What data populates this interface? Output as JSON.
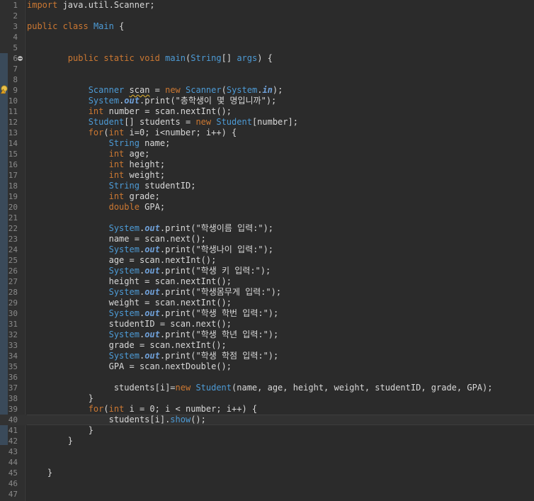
{
  "editor": {
    "lines": [
      {
        "n": "1",
        "t": [
          [
            "kw",
            "import"
          ],
          [
            "plain",
            " java.util.Scanner;"
          ]
        ]
      },
      {
        "n": "2",
        "t": []
      },
      {
        "n": "3",
        "t": [
          [
            "kw",
            "public"
          ],
          [
            "plain",
            " "
          ],
          [
            "kw",
            "class"
          ],
          [
            "plain",
            " "
          ],
          [
            "cls",
            "Main"
          ],
          [
            "plain",
            " {"
          ]
        ]
      },
      {
        "n": "4",
        "t": []
      },
      {
        "n": "5",
        "t": []
      },
      {
        "n": "6",
        "fold": true,
        "t": [
          [
            "plain",
            "        "
          ],
          [
            "kw",
            "public"
          ],
          [
            "plain",
            " "
          ],
          [
            "kw",
            "static"
          ],
          [
            "plain",
            " "
          ],
          [
            "kw",
            "void"
          ],
          [
            "plain",
            " "
          ],
          [
            "type",
            "main"
          ],
          [
            "plain",
            "("
          ],
          [
            "type",
            "String"
          ],
          [
            "plain",
            "[] "
          ],
          [
            "type",
            "args"
          ],
          [
            "plain",
            ") {"
          ]
        ]
      },
      {
        "n": "7",
        "t": []
      },
      {
        "n": "8",
        "t": []
      },
      {
        "n": "9",
        "warn": true,
        "t": [
          [
            "plain",
            "            "
          ],
          [
            "type",
            "Scanner"
          ],
          [
            "plain",
            " "
          ],
          [
            "warn",
            "scan"
          ],
          [
            "plain",
            " = "
          ],
          [
            "kw",
            "new"
          ],
          [
            "plain",
            " "
          ],
          [
            "type",
            "Scanner"
          ],
          [
            "plain",
            "("
          ],
          [
            "type",
            "System"
          ],
          [
            "plain",
            "."
          ],
          [
            "field",
            "in"
          ],
          [
            "plain",
            ");"
          ]
        ]
      },
      {
        "n": "10",
        "t": [
          [
            "plain",
            "            "
          ],
          [
            "type",
            "System"
          ],
          [
            "plain",
            "."
          ],
          [
            "field",
            "out"
          ],
          [
            "plain",
            ".print(\"총학생이 몇 명입니까\");"
          ]
        ]
      },
      {
        "n": "11",
        "t": [
          [
            "plain",
            "            "
          ],
          [
            "kw",
            "int"
          ],
          [
            "plain",
            " number = scan.nextInt();"
          ]
        ]
      },
      {
        "n": "12",
        "t": [
          [
            "plain",
            "            "
          ],
          [
            "type",
            "Student"
          ],
          [
            "plain",
            "[] students = "
          ],
          [
            "kw",
            "new"
          ],
          [
            "plain",
            " "
          ],
          [
            "type",
            "Student"
          ],
          [
            "plain",
            "[number];"
          ]
        ]
      },
      {
        "n": "13",
        "t": [
          [
            "plain",
            "            "
          ],
          [
            "kw",
            "for"
          ],
          [
            "plain",
            "("
          ],
          [
            "kw",
            "int"
          ],
          [
            "plain",
            " i=0; i<number; i++) {"
          ]
        ]
      },
      {
        "n": "14",
        "t": [
          [
            "plain",
            "                "
          ],
          [
            "type",
            "String"
          ],
          [
            "plain",
            " name;"
          ]
        ]
      },
      {
        "n": "15",
        "t": [
          [
            "plain",
            "                "
          ],
          [
            "kw",
            "int"
          ],
          [
            "plain",
            " age;"
          ]
        ]
      },
      {
        "n": "16",
        "t": [
          [
            "plain",
            "                "
          ],
          [
            "kw",
            "int"
          ],
          [
            "plain",
            " height;"
          ]
        ]
      },
      {
        "n": "17",
        "t": [
          [
            "plain",
            "                "
          ],
          [
            "kw",
            "int"
          ],
          [
            "plain",
            " weight;"
          ]
        ]
      },
      {
        "n": "18",
        "t": [
          [
            "plain",
            "                "
          ],
          [
            "type",
            "String"
          ],
          [
            "plain",
            " studentID;"
          ]
        ]
      },
      {
        "n": "19",
        "t": [
          [
            "plain",
            "                "
          ],
          [
            "kw",
            "int"
          ],
          [
            "plain",
            " grade;"
          ]
        ]
      },
      {
        "n": "20",
        "t": [
          [
            "plain",
            "                "
          ],
          [
            "kw",
            "double"
          ],
          [
            "plain",
            " GPA;"
          ]
        ]
      },
      {
        "n": "21",
        "t": []
      },
      {
        "n": "22",
        "t": [
          [
            "plain",
            "                "
          ],
          [
            "type",
            "System"
          ],
          [
            "plain",
            "."
          ],
          [
            "field",
            "out"
          ],
          [
            "plain",
            ".print(\"학생이름 입력:\");"
          ]
        ]
      },
      {
        "n": "23",
        "t": [
          [
            "plain",
            "                name = scan.next();"
          ]
        ]
      },
      {
        "n": "24",
        "t": [
          [
            "plain",
            "                "
          ],
          [
            "type",
            "System"
          ],
          [
            "plain",
            "."
          ],
          [
            "field",
            "out"
          ],
          [
            "plain",
            ".print(\"학생나이 입력:\");"
          ]
        ]
      },
      {
        "n": "25",
        "t": [
          [
            "plain",
            "                age = scan.nextInt();"
          ]
        ]
      },
      {
        "n": "26",
        "t": [
          [
            "plain",
            "                "
          ],
          [
            "type",
            "System"
          ],
          [
            "plain",
            "."
          ],
          [
            "field",
            "out"
          ],
          [
            "plain",
            ".print(\"학생 키 입력:\");"
          ]
        ]
      },
      {
        "n": "27",
        "t": [
          [
            "plain",
            "                height = scan.nextInt();"
          ]
        ]
      },
      {
        "n": "28",
        "t": [
          [
            "plain",
            "                "
          ],
          [
            "type",
            "System"
          ],
          [
            "plain",
            "."
          ],
          [
            "field",
            "out"
          ],
          [
            "plain",
            ".print(\"학생몸무게 입력:\");"
          ]
        ]
      },
      {
        "n": "29",
        "t": [
          [
            "plain",
            "                weight = scan.nextInt();"
          ]
        ]
      },
      {
        "n": "30",
        "t": [
          [
            "plain",
            "                "
          ],
          [
            "type",
            "System"
          ],
          [
            "plain",
            "."
          ],
          [
            "field",
            "out"
          ],
          [
            "plain",
            ".print(\"학생 학번 입력:\");"
          ]
        ]
      },
      {
        "n": "31",
        "t": [
          [
            "plain",
            "                studentID = scan.next();"
          ]
        ]
      },
      {
        "n": "32",
        "t": [
          [
            "plain",
            "                "
          ],
          [
            "type",
            "System"
          ],
          [
            "plain",
            "."
          ],
          [
            "field",
            "out"
          ],
          [
            "plain",
            ".print(\"학생 학년 입력:\");"
          ]
        ]
      },
      {
        "n": "33",
        "t": [
          [
            "plain",
            "                grade = scan.nextInt();"
          ]
        ]
      },
      {
        "n": "34",
        "t": [
          [
            "plain",
            "                "
          ],
          [
            "type",
            "System"
          ],
          [
            "plain",
            "."
          ],
          [
            "field",
            "out"
          ],
          [
            "plain",
            ".print(\"학생 학점 입력:\");"
          ]
        ]
      },
      {
        "n": "35",
        "t": [
          [
            "plain",
            "                GPA = scan.nextDouble();"
          ]
        ]
      },
      {
        "n": "36",
        "t": []
      },
      {
        "n": "37",
        "t": [
          [
            "plain",
            "                 students[i]="
          ],
          [
            "kw",
            "new"
          ],
          [
            "plain",
            " "
          ],
          [
            "type",
            "Student"
          ],
          [
            "plain",
            "(name, age, height, weight, studentID, grade, GPA);"
          ]
        ]
      },
      {
        "n": "38",
        "t": [
          [
            "plain",
            "            }"
          ]
        ]
      },
      {
        "n": "39",
        "t": [
          [
            "plain",
            "            "
          ],
          [
            "kw",
            "for"
          ],
          [
            "plain",
            "("
          ],
          [
            "kw",
            "int"
          ],
          [
            "plain",
            " i = 0; i < number; i++) {"
          ]
        ]
      },
      {
        "n": "40",
        "current": true,
        "t": [
          [
            "plain",
            "                students[i]."
          ],
          [
            "type",
            "show"
          ],
          [
            "plain",
            "();"
          ]
        ]
      },
      {
        "n": "41",
        "t": [
          [
            "plain",
            "            }"
          ]
        ]
      },
      {
        "n": "42",
        "t": [
          [
            "plain",
            "        }"
          ]
        ]
      },
      {
        "n": "43",
        "t": []
      },
      {
        "n": "44",
        "t": []
      },
      {
        "n": "45",
        "t": [
          [
            "plain",
            "    }"
          ]
        ]
      },
      {
        "n": "46",
        "t": []
      },
      {
        "n": "47",
        "t": []
      }
    ]
  },
  "colors": {
    "background": "#2b2b2b",
    "keyword": "#cc7832",
    "type": "#4d9bd6",
    "text": "#d8d8d8",
    "line_number": "#8a8a8a",
    "warning": "#c9a030"
  },
  "icons": {
    "fold": "collapse-circle-icon",
    "warning": "warning-lightbulb-icon"
  }
}
